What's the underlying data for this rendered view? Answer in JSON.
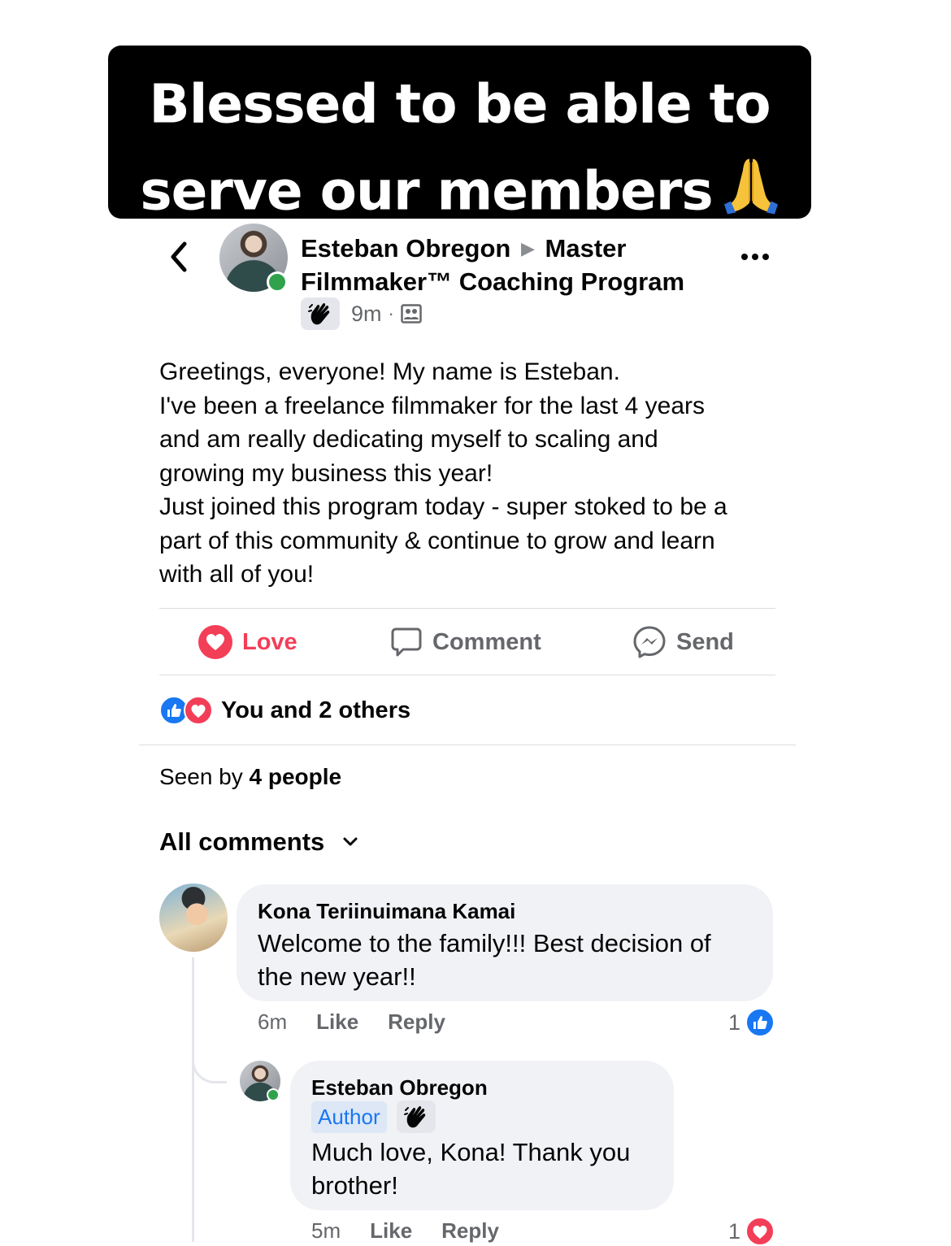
{
  "banner": {
    "line1": "Blessed to be able to",
    "line2": "serve our members",
    "emoji": "folded-hands-icon"
  },
  "post": {
    "author": "Esteban Obregon",
    "group": "Master Filmmaker™ Coaching Program",
    "time": "9m",
    "badge_icon": "wave-hand-icon",
    "audience_icon": "group-members-icon",
    "body_lines": [
      "Greetings, everyone! My name is Esteban.",
      "I've been a freelance filmmaker for the last 4 years",
      "and am really dedicating myself to scaling and",
      "growing my business this year!",
      "Just joined this program today - super stoked to be a",
      "part of this community & continue to grow and learn",
      "with all of you!"
    ]
  },
  "actions": {
    "love": "Love",
    "comment": "Comment",
    "send": "Send"
  },
  "reactions": {
    "summary": "You and 2 others"
  },
  "seen": {
    "prefix": "Seen by",
    "count": "4 people"
  },
  "comments_header": "All comments",
  "comments": [
    {
      "author": "Kona Teriinuimana Kamai",
      "text_lines": [
        "Welcome to the family!!! Best decision of",
        "the new year!!"
      ],
      "time": "6m",
      "like": "Like",
      "reply": "Reply",
      "reaction_count": "1",
      "reaction_type": "like"
    },
    {
      "author": "Esteban Obregon",
      "author_badge": "Author",
      "text_lines": [
        "Much love, Kona! Thank you",
        "brother!"
      ],
      "time": "5m",
      "like": "Like",
      "reply": "Reply",
      "reaction_count": "1",
      "reaction_type": "love"
    }
  ],
  "colors": {
    "love": "#f33e58",
    "like": "#1877f2",
    "online": "#31a24c",
    "bubble": "#f0f2f5",
    "muted": "#65676b"
  }
}
